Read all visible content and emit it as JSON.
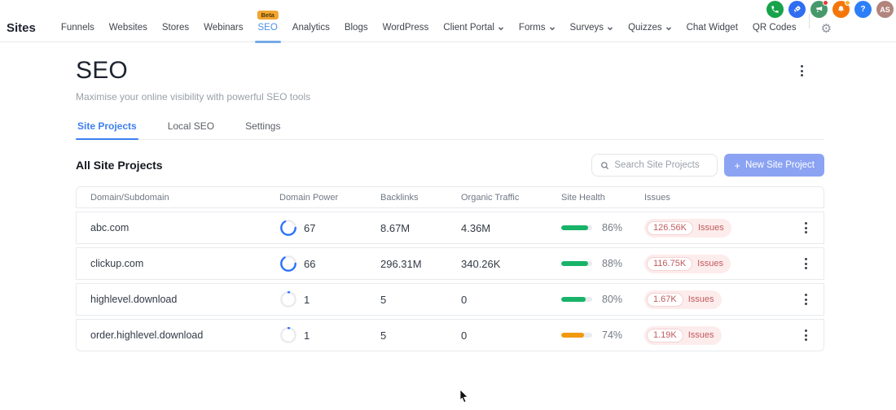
{
  "topbar": {
    "brand": "Sites",
    "nav": [
      {
        "label": "Funnels"
      },
      {
        "label": "Websites"
      },
      {
        "label": "Stores"
      },
      {
        "label": "Webinars"
      },
      {
        "label": "SEO",
        "active": true,
        "badge": "Beta"
      },
      {
        "label": "Analytics"
      },
      {
        "label": "Blogs"
      },
      {
        "label": "WordPress"
      },
      {
        "label": "Client Portal",
        "dropdown": true
      },
      {
        "label": "Forms",
        "dropdown": true
      },
      {
        "label": "Surveys",
        "dropdown": true
      },
      {
        "label": "Quizzes",
        "dropdown": true
      },
      {
        "label": "Chat Widget"
      },
      {
        "label": "QR Codes"
      }
    ],
    "gear_icon": "⚙",
    "icons": [
      "phone-icon",
      "rocket-icon",
      "megaphone-icon",
      "bell-icon",
      "help-icon"
    ],
    "account": {
      "initials": "AS"
    }
  },
  "main": {
    "title": "SEO",
    "subtitle": "Maximise your online visibility with powerful SEO tools",
    "tabs": [
      {
        "label": "Site Projects",
        "active": true
      },
      {
        "label": "Local SEO",
        "active": false
      },
      {
        "label": "Settings",
        "active": false
      }
    ]
  },
  "toolbar": {
    "heading": "All Site Projects",
    "search_placeholder": "Search Site Projects",
    "new_button": "New Site Project",
    "new_button_plus": "+"
  },
  "table": {
    "columns": [
      "Domain/Subdomain",
      "Domain Power",
      "Backlinks",
      "Organic Traffic",
      "Site Health",
      "Issues"
    ],
    "rows": [
      {
        "domain": "abc.com",
        "domain_power": 67,
        "backlinks": "8.67M",
        "organic_traffic": "4.36M",
        "site_health_pct": 86,
        "health_color": "green",
        "issues_count": "126.56K",
        "issues_label": "Issues"
      },
      {
        "domain": "clickup.com",
        "domain_power": 66,
        "backlinks": "296.31M",
        "organic_traffic": "340.26K",
        "site_health_pct": 88,
        "health_color": "green",
        "issues_count": "116.75K",
        "issues_label": "Issues"
      },
      {
        "domain": "highlevel.download",
        "domain_power": 1,
        "backlinks": "5",
        "organic_traffic": "0",
        "site_health_pct": 80,
        "health_color": "green",
        "issues_count": "1.67K",
        "issues_label": "Issues"
      },
      {
        "domain": "order.highlevel.download",
        "domain_power": 1,
        "backlinks": "5",
        "organic_traffic": "0",
        "site_health_pct": 74,
        "health_color": "orange",
        "issues_count": "1.19K",
        "issues_label": "Issues"
      }
    ]
  },
  "colors": {
    "accent_blue": "#4a90e2",
    "tab_active_blue": "#3d7ff0",
    "new_button_blue": "#8ba3f2",
    "ring_blue": "#2970ff",
    "health_green": "#18b368",
    "health_orange": "#f09a10",
    "issues_red": "#bf5a5e",
    "issues_bg": "#fdecec",
    "beta_badge_orange": "#f2a530",
    "icon_phone_green": "#17a34a",
    "icon_rocket_blue": "#2f6ef2",
    "icon_megaphone_green": "#47996b",
    "icon_bell_orange": "#f4760b",
    "icon_help_blue": "#2d7ff9",
    "avatar_brown": "#b2847c",
    "alert_red_dot": "#e53935",
    "alert_yellow_dot": "#f7b731"
  }
}
